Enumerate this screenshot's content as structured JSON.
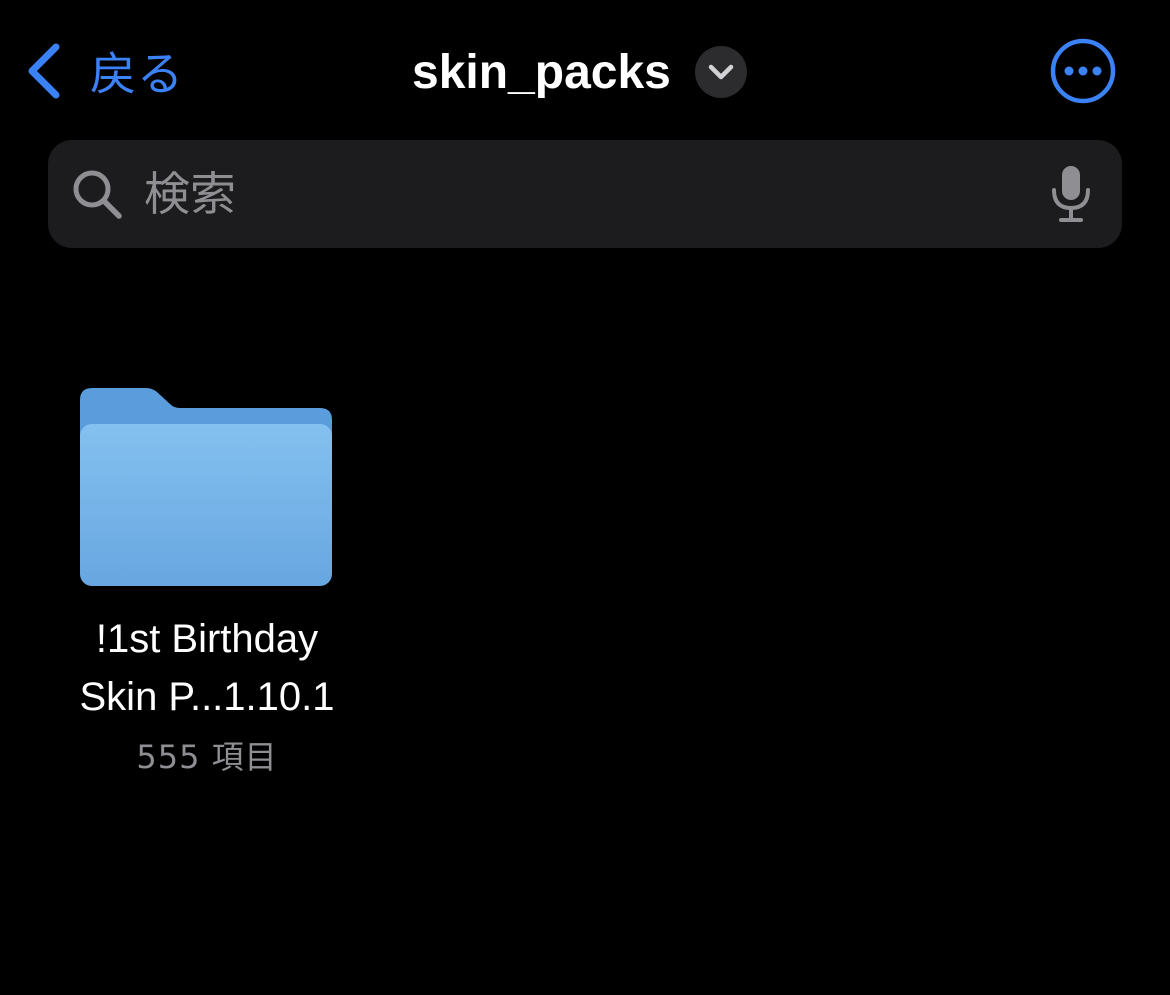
{
  "nav": {
    "back_label": "戻る",
    "title": "skin_packs",
    "back_icon": "chevron-left-icon",
    "title_menu_icon": "chevron-down-icon",
    "more_icon": "ellipsis-circle-icon"
  },
  "search": {
    "placeholder": "検索",
    "value": "",
    "search_icon": "magnifying-glass-icon",
    "mic_icon": "microphone-icon"
  },
  "items": [
    {
      "type": "folder",
      "name_line1": "!1st Birthday",
      "name_line2": "Skin P...1.10.1",
      "count": "555 項目",
      "icon": "folder-icon"
    }
  ],
  "colors": {
    "background": "#000000",
    "accent": "#3b82f6",
    "search_bg": "#1c1c1e",
    "secondary_text": "#8e8e93",
    "folder_front": "#7ab8ec",
    "folder_back": "#5a9ddd"
  }
}
